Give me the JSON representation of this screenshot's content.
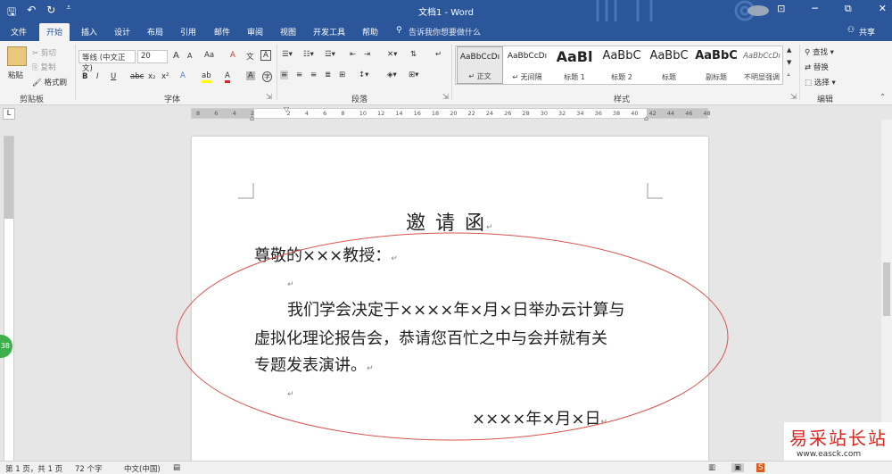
{
  "window": {
    "title": "文档1 - Word",
    "minimize": "─",
    "restore": "⧉",
    "close": "✕",
    "ribbon_toggle": "⊡"
  },
  "qat": {
    "save_icon": "save-icon",
    "undo_icon": "undo-icon",
    "redo_icon": "redo-icon",
    "customize_icon": "customize-icon"
  },
  "tabs": [
    {
      "label": "文件"
    },
    {
      "label": "开始"
    },
    {
      "label": "插入"
    },
    {
      "label": "设计"
    },
    {
      "label": "布局"
    },
    {
      "label": "引用"
    },
    {
      "label": "邮件"
    },
    {
      "label": "审阅"
    },
    {
      "label": "视图"
    },
    {
      "label": "开发工具"
    },
    {
      "label": "帮助"
    }
  ],
  "tellme": {
    "text": "告诉我你想要做什么"
  },
  "share": {
    "label": "共享"
  },
  "clipboard": {
    "paste": "粘贴",
    "cut": "剪切",
    "copy": "复制",
    "format_painter": "格式刷",
    "group": "剪贴板"
  },
  "font": {
    "name": "等线 (中文正文)",
    "size": "20",
    "group": "字体",
    "grow": "A",
    "shrink": "A",
    "case": "Aa",
    "clear": "A",
    "wen": "文",
    "border_a": "A",
    "bold": "B",
    "italic": "I",
    "underline": "U",
    "strike": "abc",
    "sub": "x₂",
    "sup": "x²",
    "effects": "A",
    "highlight": "ab",
    "color": "A",
    "shade": "A",
    "enclose": "字"
  },
  "paragraph": {
    "group": "段落"
  },
  "styles": {
    "group": "样式",
    "items": [
      {
        "preview": "AaBbCcDı",
        "name": "↵ 正文"
      },
      {
        "preview": "AaBbCcDı",
        "name": "↵ 无间隔"
      },
      {
        "preview": "AaBl",
        "name": "标题 1"
      },
      {
        "preview": "AaBbC",
        "name": "标题 2"
      },
      {
        "preview": "AaBbC",
        "name": "标题"
      },
      {
        "preview": "AaBbC",
        "name": "副标题"
      },
      {
        "preview": "AaBbCcDı",
        "name": "不明显强调"
      }
    ]
  },
  "editing": {
    "find": "查找",
    "replace": "替换",
    "select": "选择",
    "group": "编辑"
  },
  "ruler": {
    "ticks": [
      "8",
      "6",
      "4",
      "2",
      "",
      "2",
      "4",
      "6",
      "8",
      "10",
      "12",
      "14",
      "16",
      "18",
      "20",
      "22",
      "24",
      "26",
      "28",
      "30",
      "32",
      "34",
      "36",
      "38",
      "40",
      "42",
      "44",
      "46",
      "48"
    ],
    "corner": "L"
  },
  "document": {
    "title": "邀 请 函",
    "greeting": "尊敬的×××教授：",
    "line1": "我们学会决定于××××年×月×日举办云计算与",
    "line2": "虚拟化理论报告会，恭请您百忙之中与会并就有关",
    "line3": "专题发表演讲。",
    "date": "××××年×月×日",
    "para_mark": "↵"
  },
  "status": {
    "page": "第 1 页，共 1 页",
    "words": "72 个字",
    "lang": "中文(中国)"
  },
  "watermark": {
    "text": "易采站长站",
    "url": "www.easck.com"
  },
  "badge": "38",
  "colors": {
    "brand": "#2b579a",
    "ellipse": "#d9534f"
  }
}
